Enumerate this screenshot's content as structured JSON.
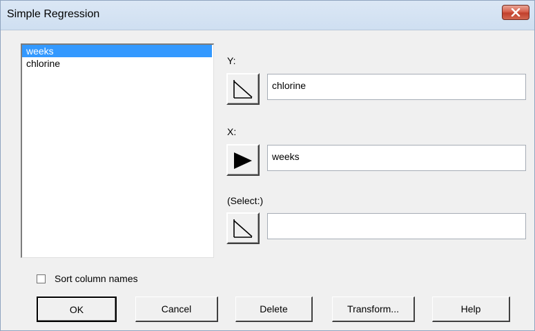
{
  "window": {
    "title": "Simple Regression"
  },
  "variables": {
    "items": [
      "weeks",
      "chlorine"
    ],
    "selected": "weeks"
  },
  "fields": {
    "y": {
      "label": "Y:",
      "value": "chlorine",
      "arrow": "outline-arrow-icon"
    },
    "x": {
      "label": "X:",
      "value": "weeks",
      "arrow": "filled-arrow-icon"
    },
    "select": {
      "label": "(Select:)",
      "value": "",
      "arrow": "outline-arrow-icon"
    }
  },
  "sort_option": {
    "label": "Sort column names",
    "checked": false
  },
  "buttons": {
    "ok": "OK",
    "cancel": "Cancel",
    "delete": "Delete",
    "transform": "Transform...",
    "help": "Help"
  },
  "colors": {
    "selection": "#3399ff",
    "close_button": "#c1402c",
    "dialog_background": "#f0f0f0"
  }
}
